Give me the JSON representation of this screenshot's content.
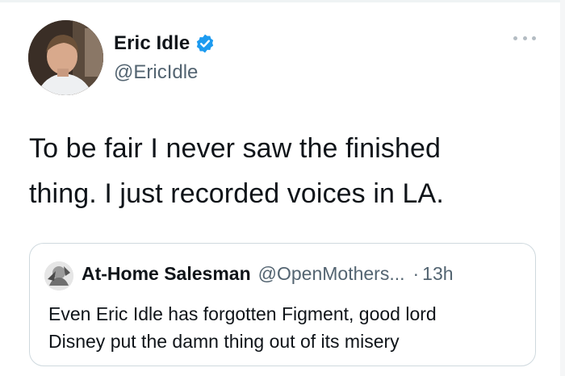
{
  "tweet": {
    "author": {
      "display_name": "Eric Idle",
      "handle": "@EricIdle",
      "verified": true,
      "avatar_icon": "author-photo"
    },
    "text_lines": [
      "To be fair I never saw the finished",
      "thing.  I just recorded voices in LA."
    ],
    "more_icon": "ellipsis-icon"
  },
  "quoted_tweet": {
    "author": {
      "display_name": "At-Home Salesman",
      "handle": "@OpenMothers...",
      "avatar_icon": "quoted-author-photo"
    },
    "separator": "·",
    "time": "13h",
    "text_lines": [
      "Even Eric Idle has forgotten Figment, good lord",
      "Disney put the damn thing out of its misery"
    ]
  },
  "colors": {
    "text_primary": "#0f1419",
    "text_secondary": "#536471",
    "verified_blue": "#1d9bf0",
    "border": "#cfd9de"
  }
}
